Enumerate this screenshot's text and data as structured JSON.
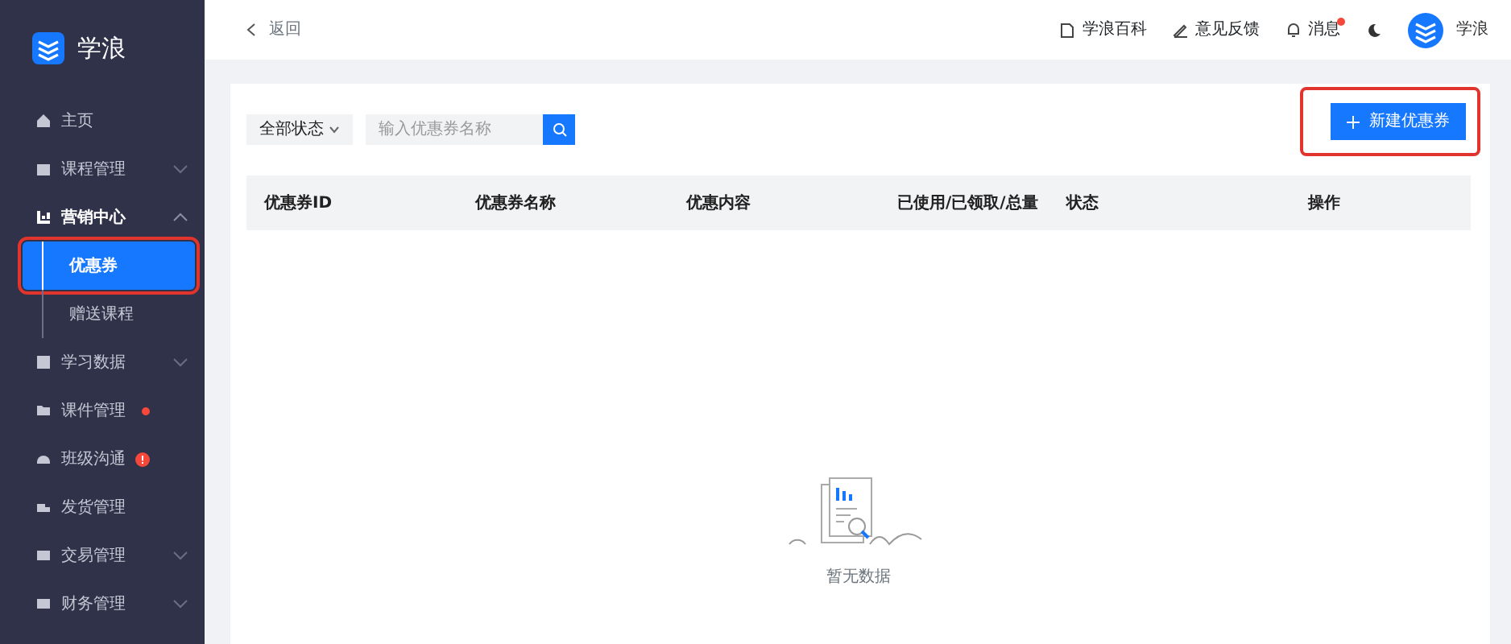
{
  "brand": {
    "name": "学浪"
  },
  "sidebar": {
    "items": [
      {
        "label": "主页",
        "expandable": false,
        "expanded": false
      },
      {
        "label": "课程管理",
        "expandable": true,
        "expanded": false
      },
      {
        "label": "营销中心",
        "expandable": true,
        "expanded": true,
        "children": [
          {
            "label": "优惠券",
            "selected": true,
            "highlighted": true
          },
          {
            "label": "赠送课程",
            "selected": false,
            "highlighted": false
          }
        ]
      },
      {
        "label": "学习数据",
        "expandable": true,
        "expanded": false
      },
      {
        "label": "课件管理",
        "expandable": false,
        "expanded": false,
        "kind": "dot"
      },
      {
        "label": "班级沟通",
        "expandable": false,
        "expanded": false,
        "kind": "alert"
      },
      {
        "label": "发货管理",
        "expandable": false,
        "expanded": false
      },
      {
        "label": "交易管理",
        "expandable": true,
        "expanded": false
      },
      {
        "label": "财务管理",
        "expandable": true,
        "expanded": false
      }
    ]
  },
  "header": {
    "back": "返回",
    "links": [
      {
        "label": "学浪百科",
        "unread": false
      },
      {
        "label": "意见反馈",
        "unread": false
      },
      {
        "label": "消息",
        "unread": true
      }
    ],
    "user": "学浪"
  },
  "toolbar": {
    "status_filter": "全部状态",
    "search": {
      "placeholder": "输入优惠券名称"
    },
    "create_button": {
      "label": "新建优惠券",
      "highlighted": true
    }
  },
  "table": {
    "columns": [
      "优惠券ID",
      "优惠券名称",
      "优惠内容",
      "已使用/已领取/总量",
      "状态",
      "操作"
    ],
    "empty_text": "暂无数据"
  }
}
